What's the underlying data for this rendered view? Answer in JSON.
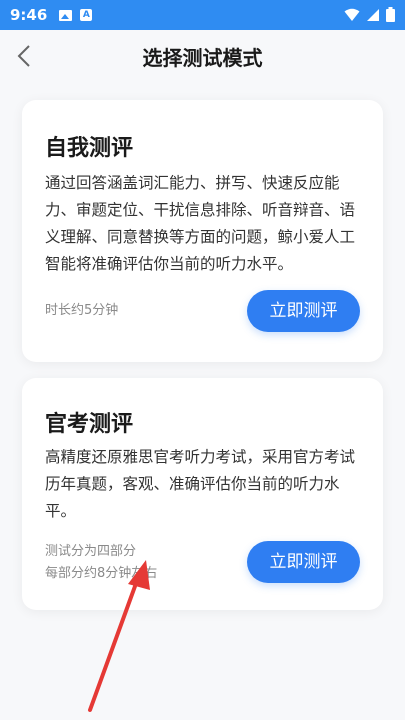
{
  "status_bar": {
    "time": "9:46"
  },
  "header": {
    "title": "选择测试模式"
  },
  "cards": [
    {
      "title": "自我测评",
      "description": "通过回答涵盖词汇能力、拼写、快速反应能力、审题定位、干扰信息排除、听音辩音、语义理解、同意替换等方面的问题，鲸小爱人工智能将准确评估你当前的听力水平。",
      "meta": [
        "时长约5分钟"
      ],
      "button_label": "立即测评"
    },
    {
      "title": "官考测评",
      "description": "高精度还原雅思官考听力考试，采用官方考试历年真题，客观、准确评估你当前的听力水平。",
      "meta": [
        "测试分为四部分",
        "每部分约8分钟左右"
      ],
      "button_label": "立即测评"
    }
  ],
  "colors": {
    "accent": "#2f7ef2",
    "status_bar": "#2f8cf2",
    "annotation_arrow": "#e53935"
  }
}
